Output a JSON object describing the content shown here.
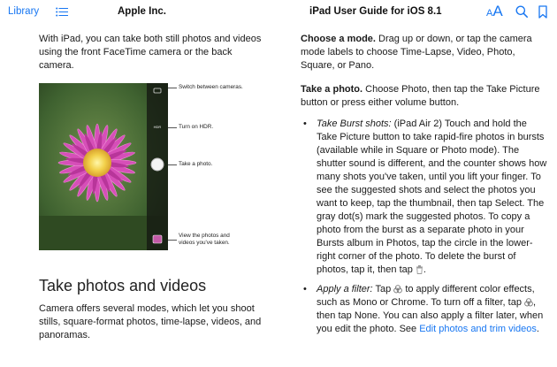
{
  "toolbar": {
    "library_label": "Library",
    "left_title": "Apple Inc.",
    "right_title": "iPad User Guide for iOS 8.1",
    "font_icon_small": "A",
    "font_icon_large": "A",
    "accent_color": "#1877f2"
  },
  "left": {
    "intro": "With iPad, you can take both still photos and videos using the front FaceTime camera or the back camera.",
    "callouts": {
      "switch_cameras": "Switch between cameras.",
      "hdr": "Turn on HDR.",
      "take_photo": "Take a photo.",
      "view_photos_1": "View the photos and",
      "view_photos_2": "videos you've taken."
    },
    "section_title": "Take photos and videos",
    "camera_modes": "Camera offers several modes, which let you shoot stills, square-format photos, time-lapse, videos, and panoramas."
  },
  "right": {
    "choose_mode_heading": "Choose a mode.",
    "choose_mode_text": "Drag up or down, or tap the camera mode labels to choose Time-Lapse, Video, Photo, Square, or Pano.",
    "take_photo_heading": "Take a photo.",
    "take_photo_text": "Choose Photo, then tap the Take Picture button or press either volume button.",
    "burst_label": "Take Burst shots:",
    "burst_text": "(iPad Air 2) Touch and hold the Take Picture button to take rapid-fire photos in bursts (available while in Square or Photo mode). The shutter sound is different, and the counter shows how many shots you've taken, until you lift your finger. To see the suggested shots and select the photos you want to keep, tap the thumbnail, then tap Select. The gray dot(s) mark the suggested photos. To copy a photo from the burst as a separate photo in your Bursts album in Photos, tap the circle in the lower-right corner of the photo. To delete the burst of photos, tap it, then tap",
    "filter_label": "Apply a filter:",
    "filter_text_1": "Tap",
    "filter_text_2": "to apply different color effects, such as Mono or Chrome. To turn off a filter, tap",
    "filter_text_3": ", then tap None. You can also apply a filter later, when you edit the photo. See",
    "filter_link": "Edit photos and trim videos",
    "filter_end": "."
  }
}
